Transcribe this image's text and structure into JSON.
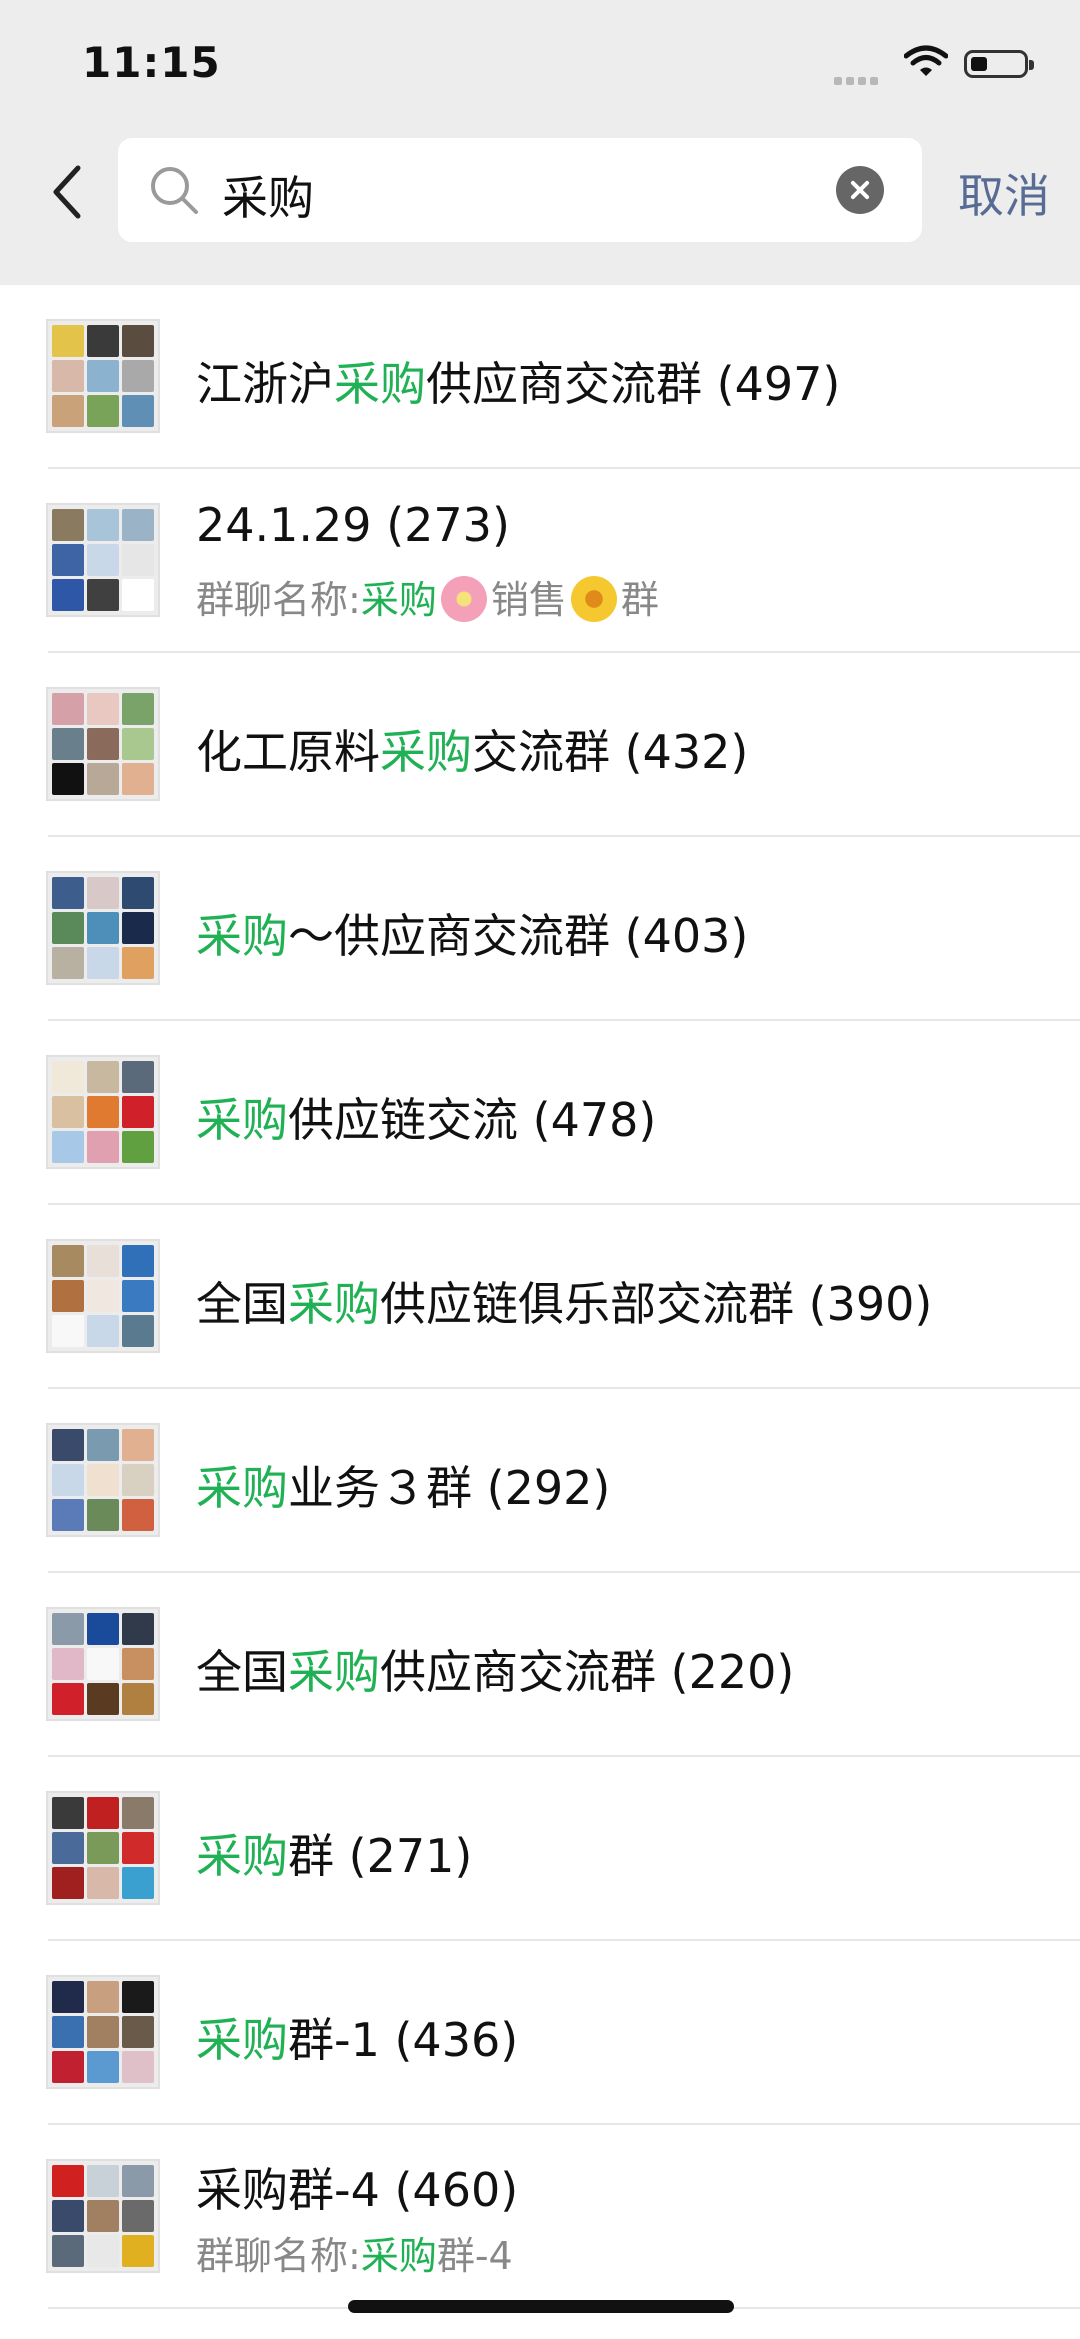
{
  "status_bar": {
    "time": "11:15"
  },
  "search": {
    "query": "采购",
    "cancel_label": "取消"
  },
  "results": [
    {
      "pre": "江浙沪",
      "hl": "采购",
      "post": "供应商交流群 (497)",
      "colors": [
        "#e3c34a",
        "#3a3a3a",
        "#5a4d3f",
        "#d8b8a8",
        "#8bb3d0",
        "#a9a9a9",
        "#c9a27a",
        "#7aa35a",
        "#5f8fb5"
      ]
    },
    {
      "title": "24.1.29 (273)",
      "sub_pre": "群聊名称:",
      "sub_hl": "采购",
      "sub_mid": "销售",
      "sub_post": "群",
      "colors": [
        "#8a7a60",
        "#a8c4d8",
        "#9ab3c7",
        "#3e64a6",
        "#c8d8e8",
        "#e6e6e6",
        "#2f57a8",
        "#404040",
        "#ffffff"
      ]
    },
    {
      "pre": "化工原料",
      "hl": "采购",
      "post": "交流群 (432)",
      "colors": [
        "#d6a0a8",
        "#e8c8c0",
        "#7aa36a",
        "#6a7f8c",
        "#8a6a5a",
        "#a8c890",
        "#111111",
        "#b8a898",
        "#e0b090"
      ]
    },
    {
      "pre": "",
      "hl": "采购",
      "post": "～供应商交流群 (403)",
      "colors": [
        "#3d5d8c",
        "#d8c8c8",
        "#2e4a70",
        "#5a8a5a",
        "#4d8fb8",
        "#1a2a4a",
        "#b8b0a0",
        "#c8d8e8",
        "#e0a060"
      ]
    },
    {
      "pre": "",
      "hl": "采购",
      "post": "供应链交流 (478)",
      "colors": [
        "#f0e8d8",
        "#c8b8a0",
        "#5a6a7a",
        "#d8c0a0",
        "#e07a30",
        "#d0202a",
        "#a8c8e8",
        "#e0a0b0",
        "#60a040"
      ]
    },
    {
      "pre": "全国",
      "hl": "采购",
      "post": "供应链俱乐部交流群 (390)",
      "colors": [
        "#a88a60",
        "#e8e0d8",
        "#2f70b8",
        "#b07040",
        "#f0e8e0",
        "#3a7ac0",
        "#f8f8f8",
        "#c8d8e8",
        "#5a7a90"
      ]
    },
    {
      "pre": "",
      "hl": "采购",
      "post": "业务３群 (292)",
      "colors": [
        "#3a4a6a",
        "#7a9ab0",
        "#e0b090",
        "#c8d8e8",
        "#f0e0d0",
        "#d8d0c0",
        "#5a7ab8",
        "#6a8a5a",
        "#d06040"
      ]
    },
    {
      "pre": "全国",
      "hl": "采购",
      "post": "供应商交流群 (220)",
      "colors": [
        "#8a9aa8",
        "#1a4a9a",
        "#303a4a",
        "#e0b8c8",
        "#f8f8f8",
        "#c89060",
        "#d0202a",
        "#5a3a20",
        "#b08040"
      ]
    },
    {
      "pre": "",
      "hl": "采购",
      "post": "群 (271)",
      "colors": [
        "#3a3a3a",
        "#c02020",
        "#8a7a6a",
        "#4a6a9a",
        "#7a9a5a",
        "#d02a2a",
        "#a02020",
        "#d8b8a8",
        "#3aa0d0"
      ]
    },
    {
      "pre": "",
      "hl": "采购",
      "post": "群-1 (436)",
      "colors": [
        "#202a4a",
        "#c8a080",
        "#1a1a1a",
        "#3a70b0",
        "#a08060",
        "#6a5a4a",
        "#c02030",
        "#5a9ad0",
        "#e0c0c8"
      ]
    },
    {
      "title": " 采购群-4 (460)",
      "sub_pre": "群聊名称:",
      "sub_hl": "采购",
      "sub_post": "群-4",
      "colors": [
        "#d02020",
        "#c8d0d8",
        "#8a9aa8",
        "#3a4a6a",
        "#a08060",
        "#6a6a6a",
        "#5a6a7a",
        "#e8e8e8",
        "#e0b020"
      ]
    }
  ]
}
